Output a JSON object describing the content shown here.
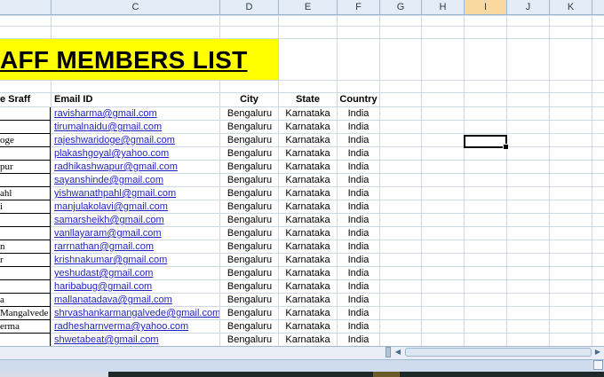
{
  "columns": [
    "",
    "C",
    "D",
    "E",
    "F",
    "G",
    "H",
    "I",
    "J",
    "K"
  ],
  "selected_column": "I",
  "title": "AFF MEMBERS LIST",
  "headers": {
    "name": "e Sraff",
    "email": "Email ID",
    "city": "City",
    "state": "State",
    "country": "Country"
  },
  "rows": [
    {
      "name": "",
      "email": "ravisharma@gmail.com",
      "city": "Bengaluru",
      "state": "Karnataka",
      "country": "India"
    },
    {
      "name": "",
      "email": "tirumalnaidu@gmail.com",
      "city": "Bengaluru",
      "state": "Karnataka",
      "country": "India"
    },
    {
      "name": "oge",
      "email": "rajeshwaridoge@gmail.com",
      "city": "Bengaluru",
      "state": "Karnataka",
      "country": "India"
    },
    {
      "name": "",
      "email": "plakashgoyal@yahoo.com",
      "city": "Bengaluru",
      "state": "Karnataka",
      "country": "India"
    },
    {
      "name": "pur",
      "email": "radhikashwapur@gmail.com",
      "city": "Bengaluru",
      "state": "Karnataka",
      "country": "India"
    },
    {
      "name": "",
      "email": "sayanshinde@gmail.com",
      "city": "Bengaluru",
      "state": "Karnataka",
      "country": "India"
    },
    {
      "name": "ahl",
      "email": "yishwanathpahl@gmail.com",
      "city": "Bengaluru",
      "state": "Karnataka",
      "country": "India"
    },
    {
      "name": "i",
      "email": "manjulakolavi@gmail.com",
      "city": "Bengaluru",
      "state": "Karnataka",
      "country": "India"
    },
    {
      "name": "",
      "email": "samarsheikh@gmail.com",
      "city": "Bengaluru",
      "state": "Karnataka",
      "country": "India"
    },
    {
      "name": "",
      "email": "vanllayaram@gmail.com",
      "city": "Bengaluru",
      "state": "Karnataka",
      "country": "India"
    },
    {
      "name": "n",
      "email": "rarrnathan@gmail.com",
      "city": "Bengaluru",
      "state": "Karnataka",
      "country": "India"
    },
    {
      "name": "r",
      "email": "krishnakumar@gmail.com",
      "city": "Bengaluru",
      "state": "Karnataka",
      "country": "India"
    },
    {
      "name": "",
      "email": "yeshudast@gmail.com",
      "city": "Bengaluru",
      "state": "Karnataka",
      "country": "India"
    },
    {
      "name": "",
      "email": "haribabug@gmail.com",
      "city": "Bengaluru",
      "state": "Karnataka",
      "country": "India"
    },
    {
      "name": "a",
      "email": "mallanatadava@gmail.com",
      "city": "Bengaluru",
      "state": "Karnataka",
      "country": "India"
    },
    {
      "name": "Mangalvede",
      "email": "shrvashankarmangalvede@gmail.com",
      "city": "Bengaluru",
      "state": "Karnataka",
      "country": "India"
    },
    {
      "name": "erma",
      "email": "radhesharnverma@yahoo.com",
      "city": "Bengaluru",
      "state": "Karnataka",
      "country": "India"
    },
    {
      "name": "",
      "email": "shwetabeat@gmail.com",
      "city": "Bengaluru",
      "state": "Karnataka",
      "country": "India"
    }
  ],
  "colors": {
    "title_band": "#ffff00",
    "link": "#1f1fc8",
    "header_bg": "#e4ecf7",
    "selected_header": "#f9d99f"
  }
}
